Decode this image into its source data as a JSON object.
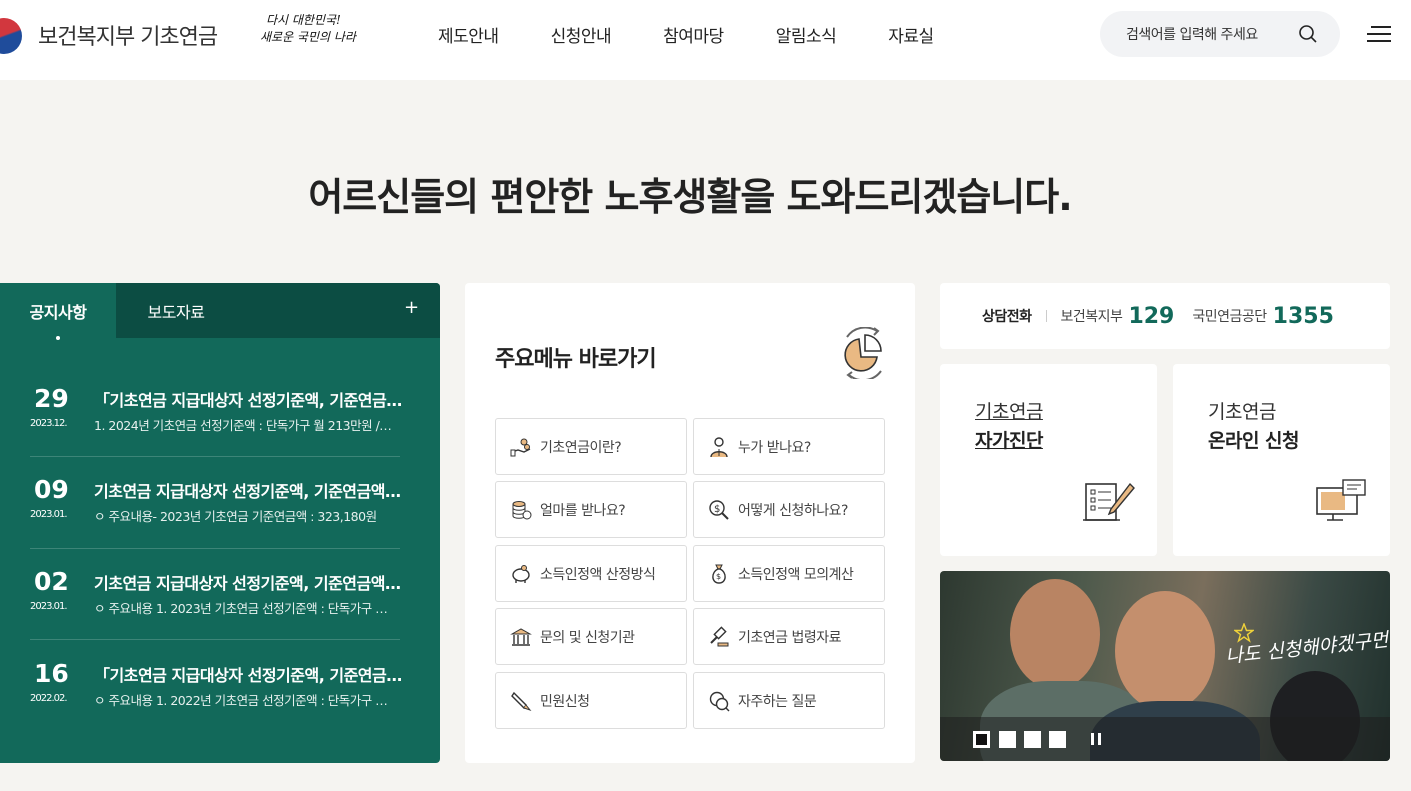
{
  "header": {
    "logo_text": "보건복지부 기초연금",
    "slogan_line1": "다시 대한민국!",
    "slogan_line2": "새로운 국민의 나라",
    "nav": [
      "제도안내",
      "신청안내",
      "참여마당",
      "알림소식",
      "자료실"
    ],
    "search_placeholder": "검색어를 입력해 주세요"
  },
  "hero": {
    "prefix": "어르신들의 ",
    "bold": "편안한 노후생활",
    "suffix": "을 도와드리겠습니다."
  },
  "notices": {
    "tabs": [
      "공지사항",
      "보도자료"
    ],
    "active_tab": "공지사항",
    "more_label": "+",
    "items": [
      {
        "day": "29",
        "ym": "2023.12.",
        "title": "「기초연금 지급대상자 선정기준액, 기준연금…",
        "summary": "1. 2024년 기초연금 선정기준액 : 단독가구 월 213만원 /…"
      },
      {
        "day": "09",
        "ym": "2023.01.",
        "title": "기초연금 지급대상자 선정기준액, 기준연금액…",
        "summary": "ㅇ 주요내용- 2023년 기초연금 기준연금액 : 323,180원"
      },
      {
        "day": "02",
        "ym": "2023.01.",
        "title": "기초연금 지급대상자 선정기준액, 기준연금액…",
        "summary": "ㅇ 주요내용 1. 2023년 기초연금 선정기준액 : 단독가구 …"
      },
      {
        "day": "16",
        "ym": "2022.02.",
        "title": "「기초연금 지급대상자 선정기준액, 기준연금…",
        "summary": "ㅇ 주요내용 1. 2022년 기초연금 선정기준액 : 단독가구 …"
      }
    ]
  },
  "main_menu": {
    "title_bold": "주요메뉴",
    "title_rest": " 바로가기",
    "buttons": [
      {
        "label": "기초연금이란?",
        "icon": "coins-hand-icon"
      },
      {
        "label": "누가 받나요?",
        "icon": "person-icon"
      },
      {
        "label": "얼마를 받나요?",
        "icon": "coin-stack-icon"
      },
      {
        "label": "어떻게 신청하나요?",
        "icon": "magnifier-dollar-icon"
      },
      {
        "label": "소득인정액 산정방식",
        "icon": "piggy-bank-icon"
      },
      {
        "label": "소득인정액 모의계산",
        "icon": "money-bag-icon"
      },
      {
        "label": "문의 및 신청기관",
        "icon": "building-icon"
      },
      {
        "label": "기초연금 법령자료",
        "icon": "gavel-icon"
      },
      {
        "label": "민원신청",
        "icon": "pen-hand-icon"
      },
      {
        "label": "자주하는 질문",
        "icon": "chat-bubbles-icon"
      }
    ]
  },
  "contact": {
    "label": "상담전화",
    "org1": "보건복지부",
    "num1": "129",
    "org2": "국민연금공단",
    "num2": "1355"
  },
  "cards": [
    {
      "line1": "기초연금",
      "line2": "자가진단",
      "icon": "checklist-pen-icon"
    },
    {
      "line1": "기초연금",
      "line2": "온라인 신청",
      "icon": "monitor-mail-icon"
    }
  ],
  "banner": {
    "caption": "나도 신청해야겠구먼!",
    "slides": 4,
    "active_slide": 1
  },
  "colors": {
    "brand_green": "#12695a",
    "tab_dark": "#0c4d43",
    "page_bg": "#f5f4f1"
  }
}
